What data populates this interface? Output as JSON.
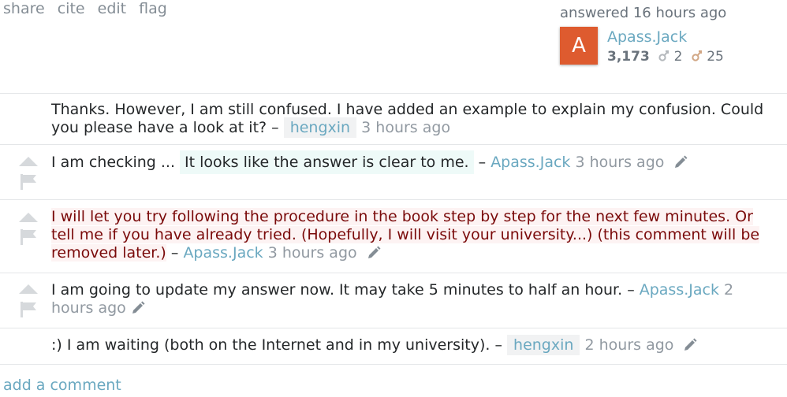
{
  "post_menu": {
    "share": "share",
    "cite": "cite",
    "edit": "edit",
    "flag": "flag"
  },
  "user_card": {
    "action": "answered",
    "time": "16 hours ago",
    "avatar_letter": "A",
    "avatar_color": "#de5b2f",
    "name": "Apass.Jack",
    "reputation": "3,173",
    "silver_badges": "2",
    "bronze_badges": "25"
  },
  "comments": [
    {
      "text": "Thanks. However, I am still confused. I have added an example to explain my confusion. Could you please have a look at it?",
      "sep": "–",
      "author": "hengxin",
      "time": "3 hours ago"
    },
    {
      "text_a": "I am checking ... ",
      "text_b": "It looks like the answer is clear to me.",
      "sep": "–",
      "author": "Apass.Jack",
      "time": "3 hours ago"
    },
    {
      "text": "I will let you try following the procedure in the book step by step for the next few minutes. Or tell me if you have already tried. (Hopefully, I will visit your university...) (this comment will be removed later.)",
      "sep": "–",
      "author": "Apass.Jack",
      "time": "3 hours ago"
    },
    {
      "text": "I am going to update my answer now. It may take 5 minutes to half an hour.",
      "sep": "–",
      "author": "Apass.Jack",
      "time": "2 hours ago"
    },
    {
      "text": ":) I am waiting (both on the Internet and in my university).",
      "sep": "–",
      "author": "hengxin",
      "time": "2 hours ago"
    }
  ],
  "add_comment": "add a comment",
  "colors": {
    "link": "#6aa8c0",
    "muted": "#9199a1",
    "highlight_red": "#7a0a0a",
    "silver": "#b4b8bc",
    "bronze": "#d1a684"
  }
}
